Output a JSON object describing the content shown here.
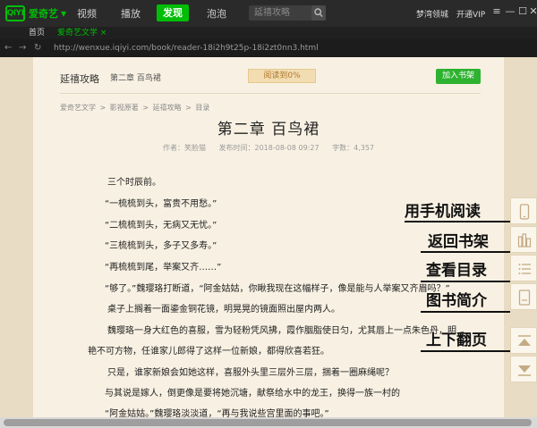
{
  "app": {
    "logo_mark": "QIYI",
    "logo_text": "爱奇艺",
    "nav": [
      "视频",
      "播放",
      "发现",
      "泡泡"
    ],
    "active_nav": "发现",
    "search_placeholder": "延禧攻略",
    "user": "梦湾领城",
    "vip": "开通VIP",
    "window_buttons": [
      "≡",
      "—",
      "☐",
      "✕"
    ]
  },
  "tabs": [
    {
      "label": "首页",
      "active": false
    },
    {
      "label": "爱奇艺文学 ×",
      "active": true
    }
  ],
  "address": {
    "url": "http://wenxue.iqiyi.com/book/reader-18i2h9t25p-18i2zt0nn3.html"
  },
  "book": {
    "title": "延禧攻略",
    "chapter_short": "第二章 百鸟裙",
    "progress": "阅读到0%",
    "add_shelf": "加入书架",
    "breadcrumb": [
      "爱奇艺文学",
      ">",
      "影视原著",
      ">",
      "延禧攻略",
      ">",
      "目录"
    ],
    "chapter_title": "第二章 百鸟裙",
    "author": "作者：笑脸猫",
    "published": "发布时间：2018-08-08 09:27",
    "word_count": "字数：4,357",
    "paragraphs": [
      "三个时辰前。",
      "“一梳梳到头，富贵不用愁。”",
      "“二梳梳到头，无病又无忧。”",
      "“三梳梳到头，多子又多寿。”",
      "“再梳梳到尾，举案又齐……”",
      "“够了。”魏璎珞打断道，“阿金姑姑，你瞅我现在这幅样子，像是能与人举案又齐眉吗？”",
      "桌子上搁着一面鎏金铜花镜，明晃晃的镜面照出屋内两人。",
      "魏璎珞一身大红色的喜服，雪为轻粉凭风拂，霞作胭脂使日匀，尤其唇上一点朱色丹，明",
      "艳不可方物，任谁家儿郎得了这样一位新娘，都得欣喜若狂。",
      "只是，谁家新娘会如她这样，喜服外头里三层外三层，捆着一圈麻绳呢？",
      "与其说是嫁人，倒更像是要将她沉塘，献祭给水中的龙王，换得一族一村的",
      "“阿金姑姑。”魏璎珞淡淡道，“再与我说些宫里面的事吧。”"
    ]
  },
  "annotations": [
    "用手机阅读",
    "返回书架",
    "查看目录",
    "图书简介",
    "上下翻页"
  ],
  "tools": [
    "phone-icon",
    "bookshelf-icon",
    "list-icon",
    "book-intro-icon",
    "page-up-icon",
    "page-down-icon"
  ],
  "colors": {
    "accent": "#00be06",
    "paper": "#f8f1e3",
    "page_bg": "#e9dcc4",
    "shelf_button": "#2eb231"
  }
}
